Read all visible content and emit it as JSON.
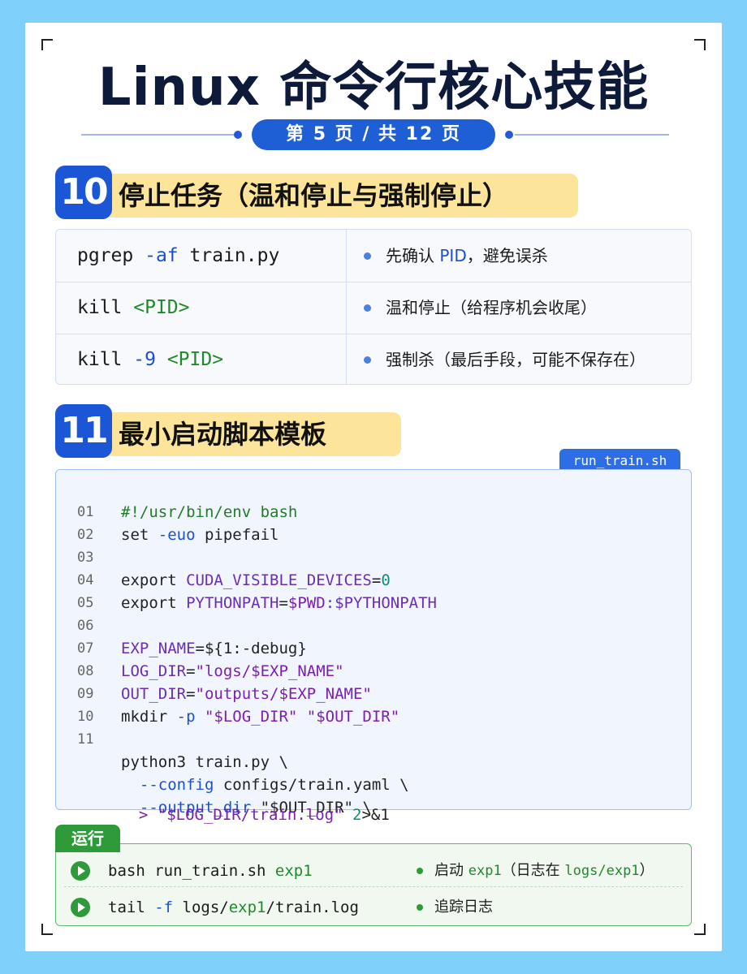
{
  "title": "Linux 命令行核心技能",
  "pager": "第 5 页 / 共 12 页",
  "section10": {
    "num": "10",
    "title": "停止任务（温和停止与强制停止）",
    "rows": [
      {
        "cmd": "pgrep",
        "flag": "-af",
        "arg": "train.py",
        "desc_a": "先确认 ",
        "desc_hl": "PID",
        "desc_b": "，避免误杀"
      },
      {
        "cmd": "kill",
        "flag": "",
        "arg": "<PID>",
        "desc_a": "温和停止（给程序机会收尾）",
        "desc_hl": "",
        "desc_b": ""
      },
      {
        "cmd": "kill",
        "flag": "-9",
        "arg": "<PID>",
        "desc_a": "强制杀（最后手段，可能不保存在）",
        "desc_hl": "",
        "desc_b": ""
      }
    ]
  },
  "section11": {
    "num": "11",
    "title": "最小启动脚本模板",
    "filename": "run_train.sh",
    "line_numbers": [
      "01",
      "02",
      "03",
      "04",
      "05",
      "06",
      "07",
      "08",
      "09",
      "10",
      "11"
    ],
    "code": {
      "l1": "#!/usr/bin/env bash",
      "l2a": "set ",
      "l2b": "-euo",
      "l2c": " pipefail",
      "l4a": "export ",
      "l4b": "CUDA_VISIBLE_DEVICES",
      "l4c": "=",
      "l4d": "0",
      "l5a": "export ",
      "l5b": "PYTHONPATH",
      "l5c": "=",
      "l5d": "$PWD",
      "l5e": ":$PYTHONPATH",
      "l7a": "EXP_NAME",
      "l7b": "=${1:-debug}",
      "l8a": "LOG_DIR",
      "l8b": "=",
      "l8c": "\"logs/$EXP_NAME\"",
      "l9a": "OUT_DIR",
      "l9b": "=",
      "l9c": "\"outputs/$EXP_NAME\"",
      "l10a": "mkdir ",
      "l10b": "-p",
      "l10c": " \"$LOG_DIR\" \"$OUT_DIR\"",
      "l12": "python3 train.py \\",
      "l13a": "  ",
      "l13b": "--config",
      "l13c": " configs/train.yaml \\",
      "l14a": "  ",
      "l14b": "--output_dir",
      "l14c": " \"$OUT_DIR\" \\",
      "l15a": "  > \"$LOG_DIR/train.log\" ",
      "l15b": "2",
      "l15c": ">&1"
    }
  },
  "run": {
    "label": "运行",
    "rows": [
      {
        "cmd": "bash run_train.sh ",
        "cmd_hl": "exp1",
        "cmd_tail": "",
        "desc_a": "启动 ",
        "desc_mono": "exp1",
        "desc_b": "（日志在 ",
        "desc_mono2": "logs/exp1",
        "desc_c": "）"
      },
      {
        "cmd": "tail ",
        "cmd_flag": "-f",
        "cmd_mid": " logs/",
        "cmd_hl": "exp1",
        "cmd_tail": "/train.log",
        "desc_a": "追踪日志"
      }
    ]
  },
  "colors": {
    "background": "#7fd0fb",
    "accent_blue": "#1a56d6",
    "highlight_yellow": "#fce59a",
    "run_green": "#2e9a3a"
  }
}
